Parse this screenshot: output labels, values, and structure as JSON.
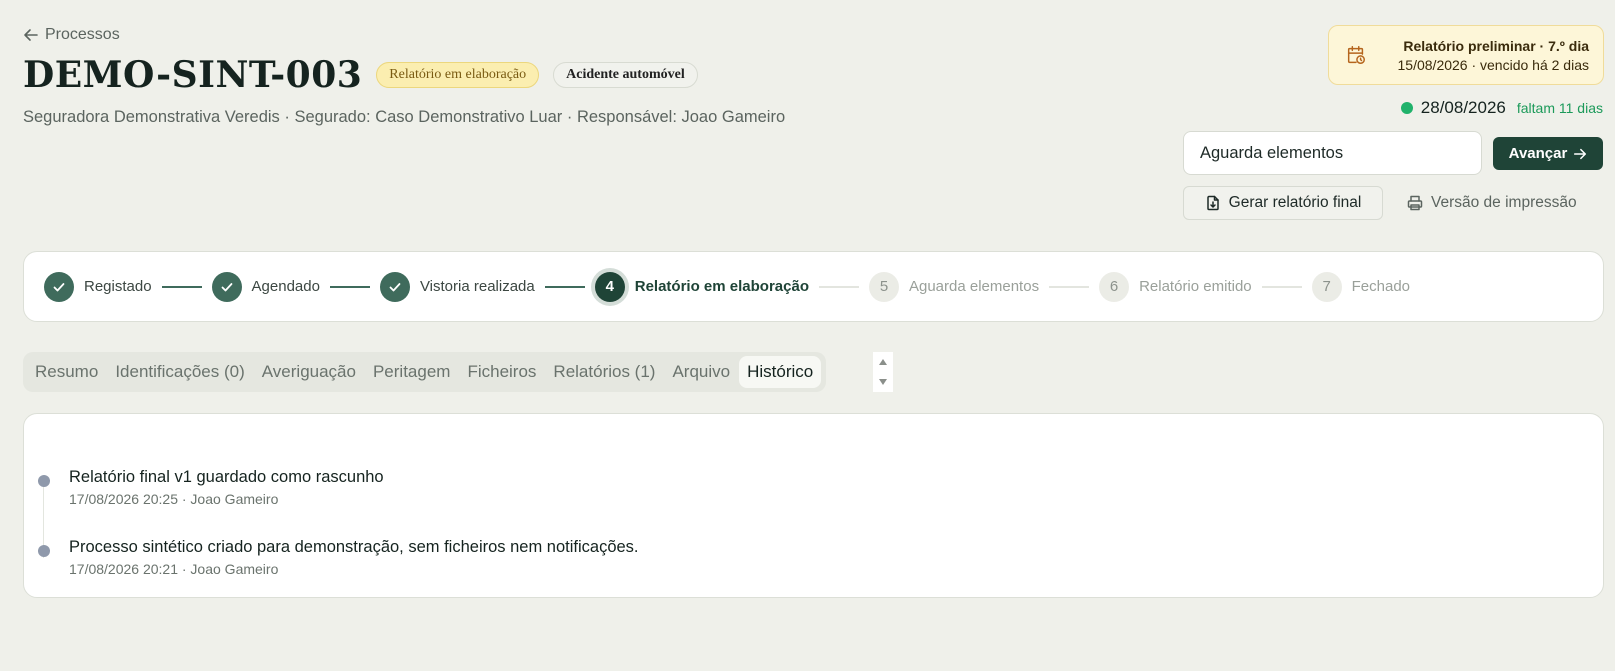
{
  "header": {
    "back_label": "Processos",
    "title": "DEMO-SINT-003",
    "status_badge": "Relatório em elaboração",
    "type_badge": "Acidente automóvel",
    "subtitle": "Seguradora Demonstrativa Veredis · Segurado: Caso Demonstrativo Luar · Responsável: Joao Gameiro"
  },
  "deadline": {
    "title": "Relatório preliminar · 7.º dia",
    "subtitle": "15/08/2026 · vencido há 2 dias"
  },
  "due": {
    "date": "28/08/2026",
    "remaining": "faltam 11 dias"
  },
  "actions": {
    "state_select_value": "Aguarda elementos",
    "advance_label": "Avançar",
    "final_report_label": "Gerar relatório final",
    "print_label": "Versão de impressão"
  },
  "stepper": {
    "steps": [
      {
        "number": "1",
        "label": "Registado",
        "state": "done"
      },
      {
        "number": "2",
        "label": "Agendado",
        "state": "done"
      },
      {
        "number": "3",
        "label": "Vistoria realizada",
        "state": "done"
      },
      {
        "number": "4",
        "label": "Relatório em elaboração",
        "state": "current"
      },
      {
        "number": "5",
        "label": "Aguarda elementos",
        "state": "todo"
      },
      {
        "number": "6",
        "label": "Relatório emitido",
        "state": "todo"
      },
      {
        "number": "7",
        "label": "Fechado",
        "state": "todo"
      }
    ]
  },
  "tabs": [
    {
      "label": "Resumo",
      "active": false
    },
    {
      "label": "Identificações (0)",
      "active": false
    },
    {
      "label": "Averiguação",
      "active": false
    },
    {
      "label": "Peritagem",
      "active": false
    },
    {
      "label": "Ficheiros",
      "active": false
    },
    {
      "label": "Relatórios (1)",
      "active": false
    },
    {
      "label": "Arquivo",
      "active": false
    },
    {
      "label": "Histórico",
      "active": true
    }
  ],
  "history": [
    {
      "text": "Relatório final v1 guardado como rascunho",
      "meta": "17/08/2026 20:25 · Joao Gameiro"
    },
    {
      "text": "Processo sintético criado para demonstração, sem ficheiros nem notificações.",
      "meta": "17/08/2026 20:21 · Joao Gameiro"
    }
  ],
  "colors": {
    "background": "#eff0ea",
    "primary": "#1f4437",
    "step_done": "#3f6b5c",
    "status_badge_bg": "#fbeeb0",
    "deadline_card_bg": "#fdf6d8",
    "due_ok": "#20b26b",
    "timeline_dot": "#8f99ab"
  },
  "icons": {
    "back": "arrow-left-icon",
    "deadline": "calendar-clock-icon",
    "advance": "arrow-right-icon",
    "final_report": "file-download-icon",
    "print": "printer-icon",
    "step_done": "check-icon"
  }
}
